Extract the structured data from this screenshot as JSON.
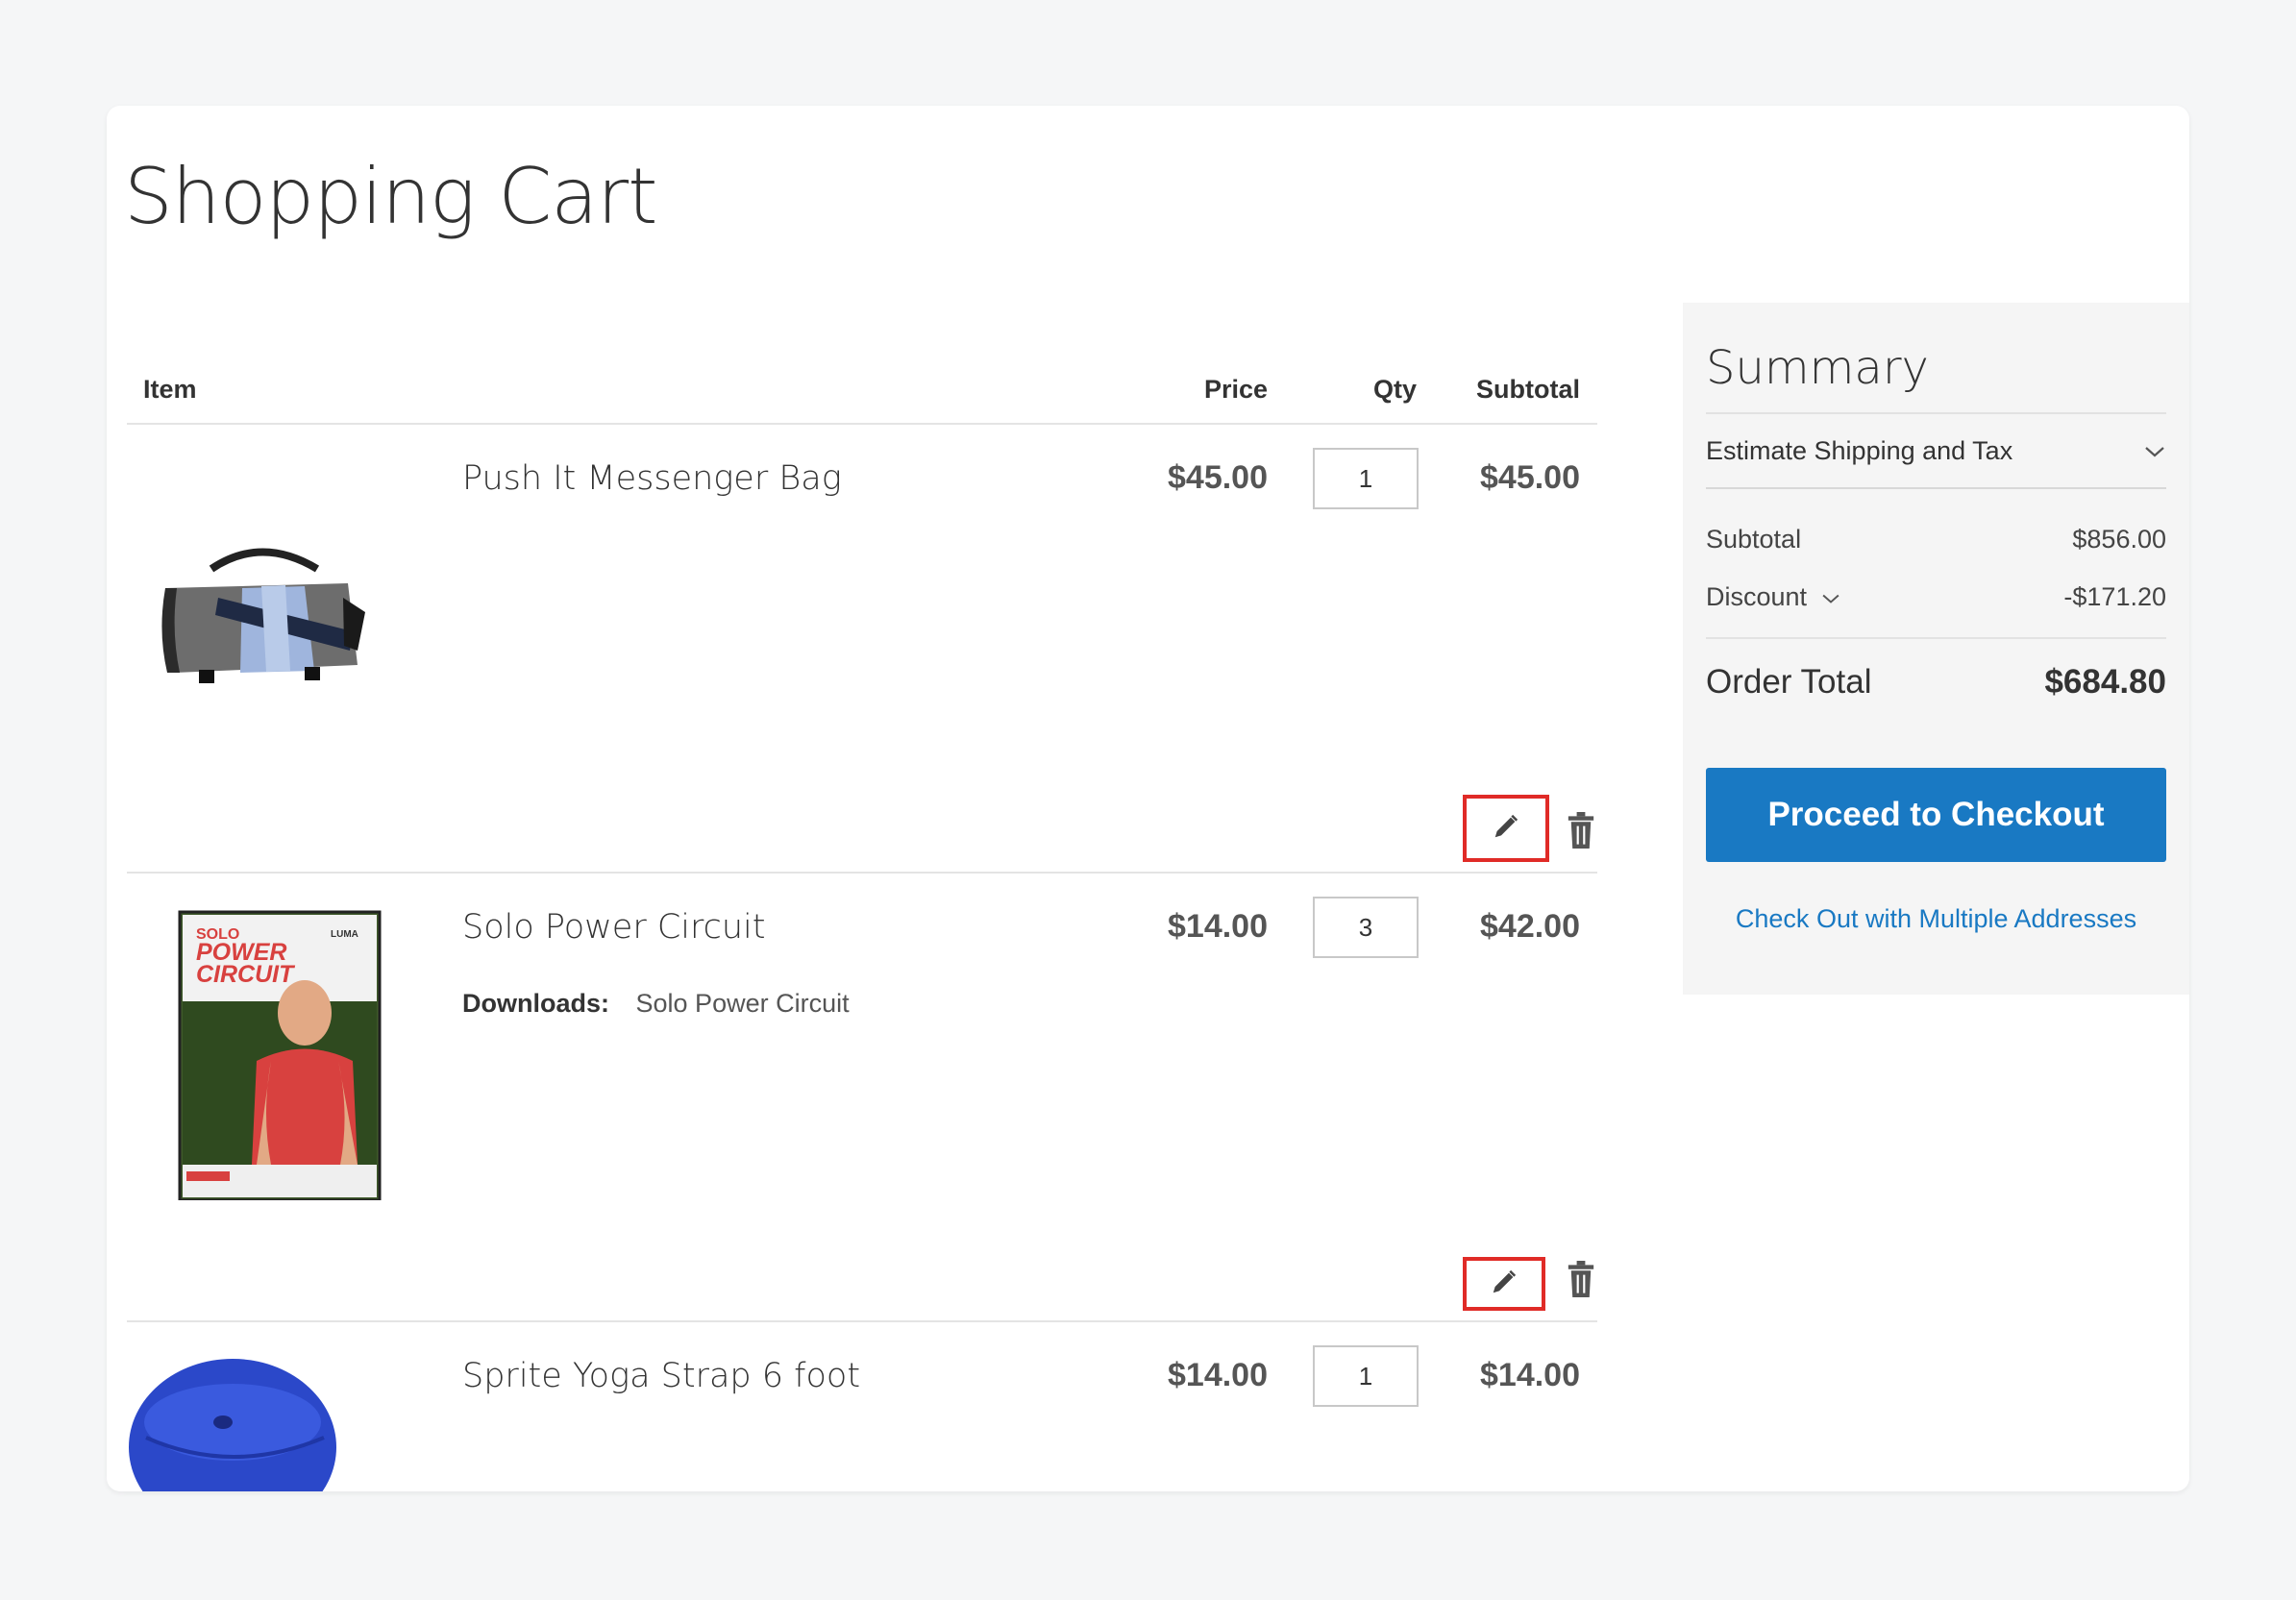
{
  "page": {
    "title": "Shopping Cart"
  },
  "cart": {
    "headers": {
      "item": "Item",
      "price": "Price",
      "qty": "Qty",
      "subtotal": "Subtotal"
    },
    "items": [
      {
        "name": "Push It Messenger Bag",
        "price": "$45.00",
        "qty": "1",
        "subtotal": "$45.00"
      },
      {
        "name": "Solo Power Circuit",
        "price": "$14.00",
        "qty": "3",
        "subtotal": "$42.00",
        "option_label": "Downloads:",
        "option_value": "Solo Power Circuit"
      },
      {
        "name": "Sprite Yoga Strap 6 foot",
        "price": "$14.00",
        "qty": "1",
        "subtotal": "$14.00"
      }
    ]
  },
  "dvd_cover": {
    "line1": "SOLO",
    "line2": "POWER",
    "line3": "CIRCUIT",
    "brand": "LUMA"
  },
  "summary": {
    "title": "Summary",
    "shipping_label": "Estimate Shipping and Tax",
    "subtotal_label": "Subtotal",
    "subtotal_value": "$856.00",
    "discount_label": "Discount",
    "discount_value": "-$171.20",
    "order_total_label": "Order Total",
    "order_total_value": "$684.80",
    "checkout_label": "Proceed to Checkout",
    "multi_address_label": "Check Out with Multiple Addresses"
  },
  "colors": {
    "accent": "#1979c3",
    "highlight": "#e02b27",
    "background": "#f5f6f7"
  },
  "icons": {
    "edit": "pencil-icon",
    "delete": "trash-icon",
    "expand": "chevron-down-icon"
  }
}
